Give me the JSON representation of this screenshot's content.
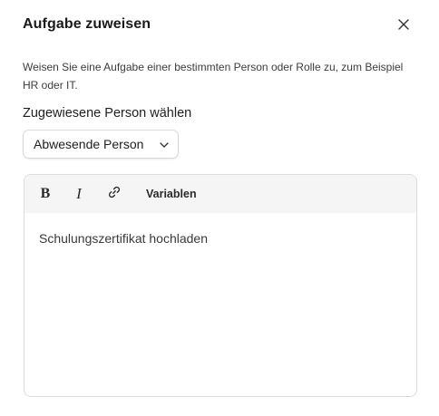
{
  "dialog": {
    "title": "Aufgabe zuweisen",
    "description": "Weisen Sie eine Aufgabe einer bestimmten Person oder Rolle zu, zum Beispiel HR oder IT.",
    "close_icon": "close-icon"
  },
  "assignee": {
    "label": "Zugewiesene Person wählen",
    "selected_value": "Abwesende Person",
    "chevron_icon": "chevron-down-icon"
  },
  "editor": {
    "toolbar": {
      "bold_label": "B",
      "italic_label": "I",
      "link_icon": "link-icon",
      "variables_label": "Variablen"
    },
    "content": "Schulungszertifikat hochladen"
  }
}
